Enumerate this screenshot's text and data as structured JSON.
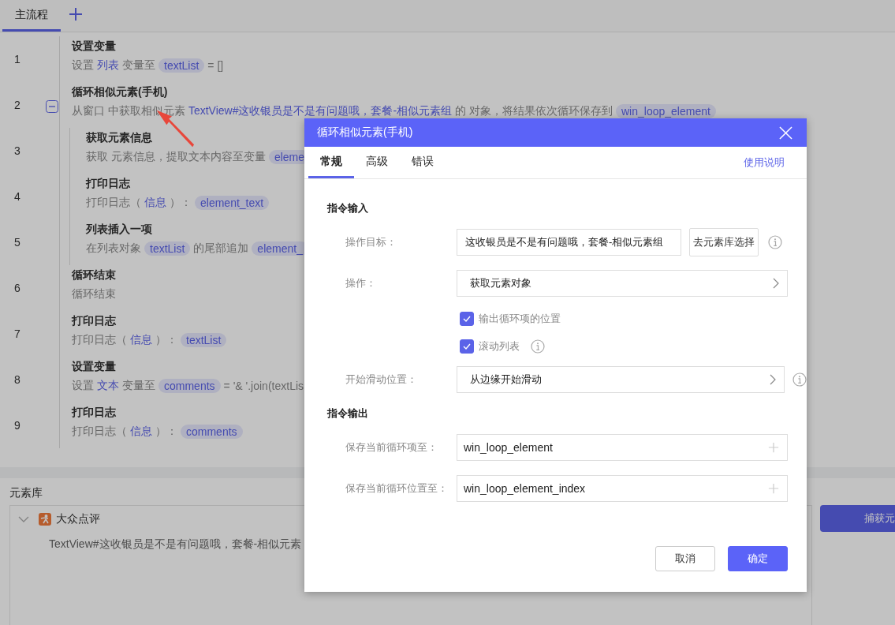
{
  "tabs": [
    {
      "label": "主流程",
      "selected": true
    }
  ],
  "steps": [
    {
      "number": "1",
      "title": "设置变量",
      "desc": [
        {
          "kind": "text",
          "text": "设置"
        },
        {
          "kind": "link",
          "text": "列表"
        },
        {
          "kind": "text",
          "text": "变量至"
        },
        {
          "kind": "chip",
          "text": "textList"
        },
        {
          "kind": "text",
          "text": "= []"
        }
      ]
    },
    {
      "number": "2",
      "title": "循环相似元素(手机)",
      "expanded": true,
      "desc": [
        {
          "kind": "text",
          "text": "从窗口 中获取相似元素"
        },
        {
          "kind": "link",
          "text": "TextView#这收银员是不是有问题哦，套餐-相似元素组"
        },
        {
          "kind": "text",
          "text": "的 对象，将结果依次循环保存到"
        },
        {
          "kind": "chip",
          "text": "win_loop_element"
        }
      ],
      "children": [
        {
          "number": "3",
          "title": "获取元素信息",
          "desc": [
            {
              "kind": "text",
              "text": "获取 元素信息，提取文本内容至变量"
            },
            {
              "kind": "chip",
              "text": "eleme"
            }
          ]
        },
        {
          "number": "4",
          "title": "打印日志",
          "desc": [
            {
              "kind": "text",
              "text": "打印日志（"
            },
            {
              "kind": "link",
              "text": "信息"
            },
            {
              "kind": "text",
              "text": "）："
            },
            {
              "kind": "chip",
              "text": "element_text"
            }
          ]
        },
        {
          "number": "5",
          "title": "列表插入一项",
          "desc": [
            {
              "kind": "text",
              "text": "在列表对象"
            },
            {
              "kind": "chip",
              "text": "textList"
            },
            {
              "kind": "text",
              "text": "的尾部追加"
            },
            {
              "kind": "chip",
              "text": "element_"
            }
          ]
        }
      ]
    },
    {
      "number": "6",
      "title": "循环结束",
      "desc": [
        {
          "kind": "text",
          "text": "循环结束"
        }
      ]
    },
    {
      "number": "7",
      "title": "打印日志",
      "desc": [
        {
          "kind": "text",
          "text": "打印日志（"
        },
        {
          "kind": "link",
          "text": "信息"
        },
        {
          "kind": "text",
          "text": "）："
        },
        {
          "kind": "chip",
          "text": "textList"
        }
      ]
    },
    {
      "number": "8",
      "title": "设置变量",
      "desc": [
        {
          "kind": "text",
          "text": "设置"
        },
        {
          "kind": "link",
          "text": "文本"
        },
        {
          "kind": "text",
          "text": "变量至"
        },
        {
          "kind": "chip",
          "text": "comments"
        },
        {
          "kind": "text",
          "text": "= '& '.join(textLis"
        }
      ]
    },
    {
      "number": "9",
      "title": "打印日志",
      "desc": [
        {
          "kind": "text",
          "text": "打印日志（"
        },
        {
          "kind": "link",
          "text": "信息"
        },
        {
          "kind": "text",
          "text": "）："
        },
        {
          "kind": "chip",
          "text": "comments"
        }
      ]
    }
  ],
  "library": {
    "title": "元素库",
    "capture_button": "捕获元",
    "apps": [
      {
        "name": "大众点评",
        "expanded": true,
        "elements": [
          "TextView#这收银员是不是有问题哦，套餐-相似元素"
        ]
      }
    ]
  },
  "dialog": {
    "title": "循环相似元素(手机)",
    "tabs": [
      {
        "label": "常规",
        "selected": true
      },
      {
        "label": "高级",
        "selected": false
      },
      {
        "label": "错误",
        "selected": false
      }
    ],
    "help_link": "使用说明",
    "sections": [
      {
        "heading": "指令输入",
        "rows": [
          {
            "kind": "input",
            "label": "操作目标：",
            "value": "这收银员是不是有问题哦，套餐-相似元素组",
            "button": "去元素库选择",
            "info": true
          },
          {
            "kind": "select",
            "label": "操作：",
            "value": "获取元素对象"
          },
          {
            "kind": "checkbox",
            "label": "输出循环项的位置",
            "checked": true
          },
          {
            "kind": "checkbox",
            "label": "滚动列表",
            "checked": true,
            "info": true
          },
          {
            "kind": "select",
            "label": "开始滑动位置：",
            "value": "从边缘开始滑动",
            "info": true
          }
        ]
      },
      {
        "heading": "指令输出",
        "rows": [
          {
            "kind": "variable",
            "label": "保存当前循环项至：",
            "value": "win_loop_element"
          },
          {
            "kind": "variable",
            "label": "保存当前循环位置至：",
            "value": "win_loop_element_index"
          }
        ]
      }
    ],
    "buttons": [
      {
        "label": "取消",
        "primary": false
      },
      {
        "label": "确定",
        "primary": true
      }
    ]
  }
}
